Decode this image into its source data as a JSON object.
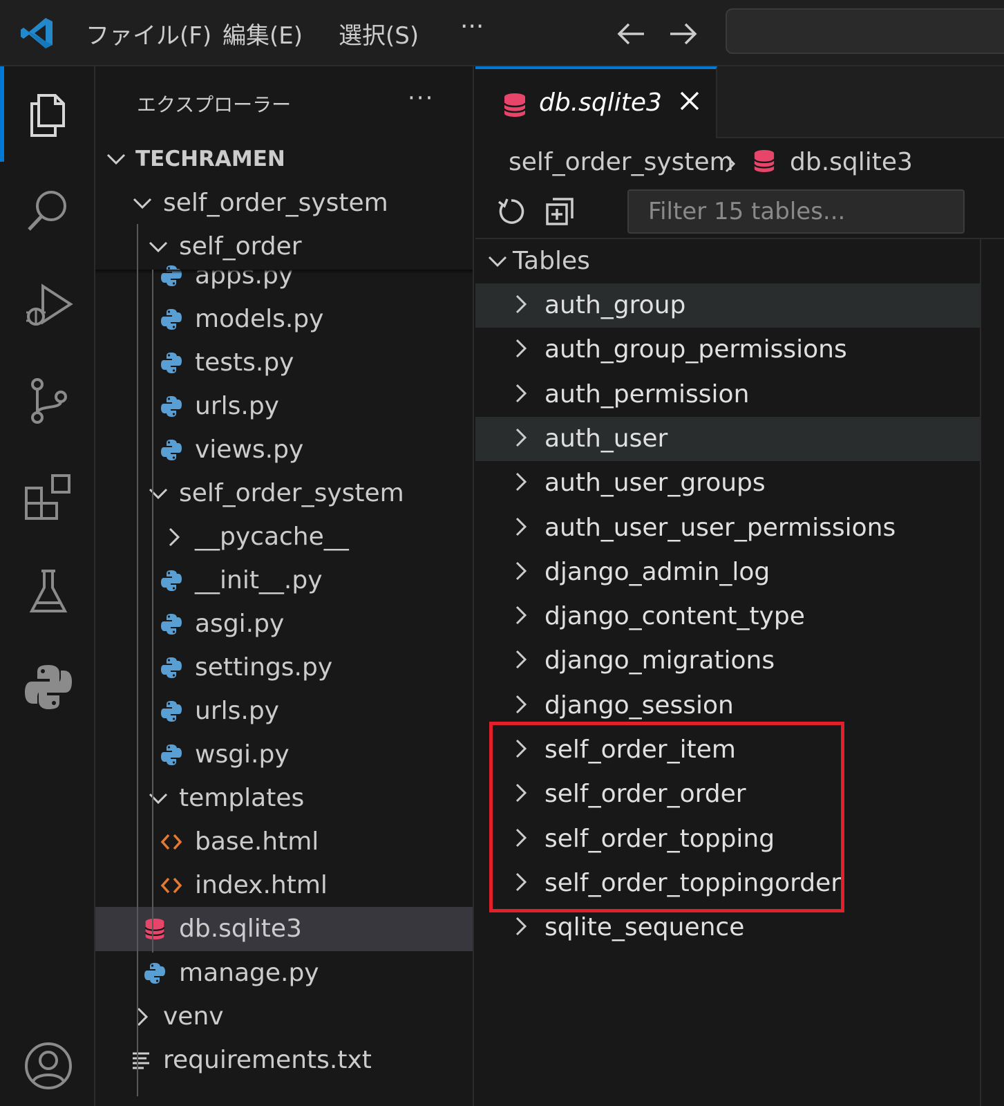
{
  "titlebar": {
    "menus": [
      "ファイル(F)",
      "編集(E)",
      "選択(S)",
      "···"
    ],
    "back_icon": "arrow-left-icon",
    "forward_icon": "arrow-right-icon"
  },
  "activity_bar": {
    "icons": [
      "files-icon",
      "search-icon",
      "run-debug-icon",
      "source-control-icon",
      "extensions-icon",
      "testing-icon",
      "python-icon",
      "account-icon"
    ]
  },
  "sidebar": {
    "title": "エクスプローラー",
    "more": "···",
    "root": "TECHRAMEN",
    "tree": [
      {
        "label": "self_order_system",
        "type": "folder",
        "open": true,
        "depth": 1
      },
      {
        "label": "self_order",
        "type": "folder",
        "open": true,
        "depth": 2
      },
      {
        "label": "apps.py",
        "type": "python",
        "depth": 3
      },
      {
        "label": "models.py",
        "type": "python",
        "depth": 3
      },
      {
        "label": "tests.py",
        "type": "python",
        "depth": 3
      },
      {
        "label": "urls.py",
        "type": "python",
        "depth": 3
      },
      {
        "label": "views.py",
        "type": "python",
        "depth": 3
      },
      {
        "label": "self_order_system",
        "type": "folder",
        "open": true,
        "depth": 2
      },
      {
        "label": "__pycache__",
        "type": "folder",
        "open": false,
        "depth": 3
      },
      {
        "label": "__init__.py",
        "type": "python",
        "depth": 3
      },
      {
        "label": "asgi.py",
        "type": "python",
        "depth": 3
      },
      {
        "label": "settings.py",
        "type": "python",
        "depth": 3
      },
      {
        "label": "urls.py",
        "type": "python",
        "depth": 3
      },
      {
        "label": "wsgi.py",
        "type": "python",
        "depth": 3
      },
      {
        "label": "templates",
        "type": "folder",
        "open": true,
        "depth": 2
      },
      {
        "label": "base.html",
        "type": "html",
        "depth": 3
      },
      {
        "label": "index.html",
        "type": "html",
        "depth": 3
      },
      {
        "label": "db.sqlite3",
        "type": "database",
        "depth": 2,
        "selected": true
      },
      {
        "label": "manage.py",
        "type": "python",
        "depth": 2
      },
      {
        "label": "venv",
        "type": "folder",
        "open": false,
        "depth": 1
      },
      {
        "label": "requirements.txt",
        "type": "text",
        "depth": 1
      }
    ]
  },
  "editor": {
    "tab_title": "db.sqlite3",
    "breadcrumb": [
      "self_order_system",
      "db.sqlite3"
    ],
    "filter_placeholder": "Filter 15 tables...",
    "tables_header": "Tables",
    "tables": [
      "auth_group",
      "auth_group_permissions",
      "auth_permission",
      "auth_user",
      "auth_user_groups",
      "auth_user_user_permissions",
      "django_admin_log",
      "django_content_type",
      "django_migrations",
      "django_session",
      "self_order_item",
      "self_order_order",
      "self_order_topping",
      "self_order_toppingorder",
      "sqlite_sequence"
    ],
    "hovered_tables": [
      "auth_group",
      "auth_user"
    ]
  },
  "colors": {
    "accent": "#0078d4",
    "database_icon": "#e8456b",
    "python_icon": "#5a9fd4",
    "html_icon": "#e37933",
    "highlight_box": "#e0202a"
  }
}
